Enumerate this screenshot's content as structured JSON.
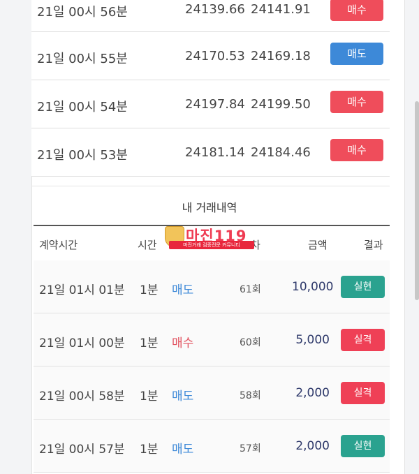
{
  "trades": [
    {
      "time": "21일 00시 56분",
      "open": "24139.66",
      "close": "24141.91",
      "action": "매수",
      "type": "buy"
    },
    {
      "time": "21일 00시 55분",
      "open": "24170.53",
      "close": "24169.18",
      "action": "매도",
      "type": "sell"
    },
    {
      "time": "21일 00시 54분",
      "open": "24197.84",
      "close": "24199.50",
      "action": "매수",
      "type": "buy"
    },
    {
      "time": "21일 00시 53분",
      "open": "24181.14",
      "close": "24184.46",
      "action": "매수",
      "type": "buy"
    }
  ],
  "history": {
    "title": "내 거래내역",
    "columns": {
      "time": "계약시간",
      "duration": "시간",
      "round": "차",
      "amount": "금액",
      "result": "결과"
    },
    "rows": [
      {
        "time": "21일 01시 01분",
        "duration": "1분",
        "direction": "매도",
        "round": "61회",
        "amount": "10,000",
        "result": "실현"
      },
      {
        "time": "21일 01시 00분",
        "duration": "1분",
        "direction": "매수",
        "round": "60회",
        "amount": "5,000",
        "result": "실격"
      },
      {
        "time": "21일 00시 58분",
        "duration": "1분",
        "direction": "매도",
        "round": "58회",
        "amount": "2,000",
        "result": "실격"
      },
      {
        "time": "21일 00시 57분",
        "duration": "1분",
        "direction": "매도",
        "round": "57회",
        "amount": "2,000",
        "result": "실현"
      }
    ]
  },
  "watermark": {
    "name": "마진",
    "suffix": "119",
    "tagline": "마진거래 검증전문 커뮤니티"
  },
  "colors": {
    "buy": "#ef4d5b",
    "sell": "#3d89d8",
    "win": "#2aa28f",
    "lose": "#ef4056",
    "amount": "#2f3a6b"
  }
}
